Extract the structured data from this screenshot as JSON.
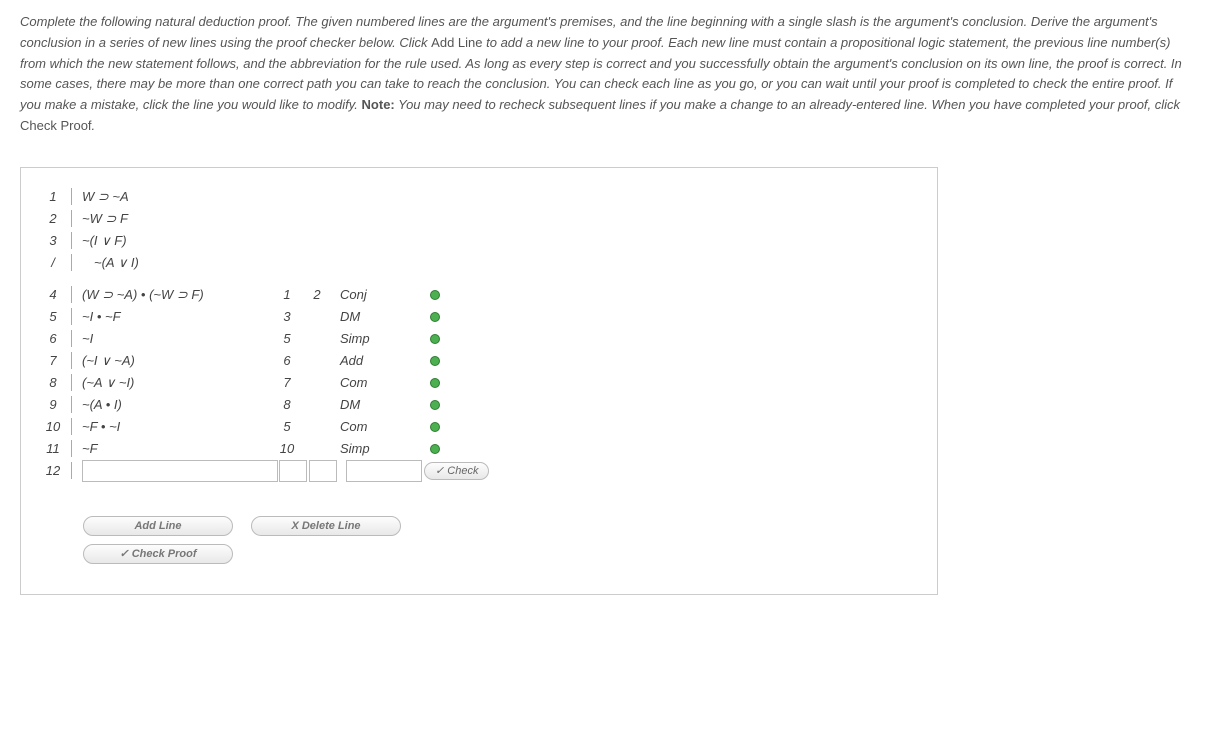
{
  "instructions": {
    "part1": "Complete the following natural deduction proof. The given numbered lines are the argument's premises, and the line beginning with a single slash is the argument's conclusion. Derive the argument's conclusion in a series of new lines using the proof checker below. Click ",
    "addline": "Add Line",
    "part2": " to add a new line to your proof. Each new line must contain a propositional logic statement, the previous line number(s) from which the new statement follows, and the abbreviation for the rule used. As long as every step is correct and you successfully obtain the argument's conclusion on its own line, the proof is correct. In some cases, there may be more than one correct path you can take to reach the conclusion. You can check each line as you go, or you can wait until your proof is completed to check the entire proof. If you make a mistake, click the line you would like to modify. ",
    "note_label": "Note:",
    "part3": " You may need to recheck subsequent lines if you make a change to an already-entered line. When you have completed your proof, click ",
    "checkproof": "Check Proof",
    "part4": "."
  },
  "premises": [
    {
      "num": "1",
      "stmt": "W ⊃ ~A"
    },
    {
      "num": "2",
      "stmt": "~W ⊃ F"
    },
    {
      "num": "3",
      "stmt": "~(I ∨ F)"
    }
  ],
  "conclusion": {
    "num": "/",
    "stmt": "~(A ∨ I)"
  },
  "derived": [
    {
      "num": "4",
      "stmt": "(W ⊃ ~A) • (~W ⊃ F)",
      "ref1": "1",
      "ref2": "2",
      "rule": "Conj"
    },
    {
      "num": "5",
      "stmt": "~I • ~F",
      "ref1": "3",
      "ref2": "",
      "rule": "DM"
    },
    {
      "num": "6",
      "stmt": "~I",
      "ref1": "5",
      "ref2": "",
      "rule": "Simp"
    },
    {
      "num": "7",
      "stmt": "(~I ∨ ~A)",
      "ref1": "6",
      "ref2": "",
      "rule": "Add"
    },
    {
      "num": "8",
      "stmt": "(~A ∨ ~I)",
      "ref1": "7",
      "ref2": "",
      "rule": "Com"
    },
    {
      "num": "9",
      "stmt": "~(A • I)",
      "ref1": "8",
      "ref2": "",
      "rule": "DM"
    },
    {
      "num": "10",
      "stmt": "~F • ~I",
      "ref1": "5",
      "ref2": "",
      "rule": "Com"
    },
    {
      "num": "11",
      "stmt": "~F",
      "ref1": "10",
      "ref2": "",
      "rule": "Simp"
    }
  ],
  "input_line": {
    "num": "12"
  },
  "buttons": {
    "check": "✓ Check",
    "add_line": "Add Line",
    "delete_line": "X  Delete Line",
    "check_proof": "✓  Check Proof"
  }
}
